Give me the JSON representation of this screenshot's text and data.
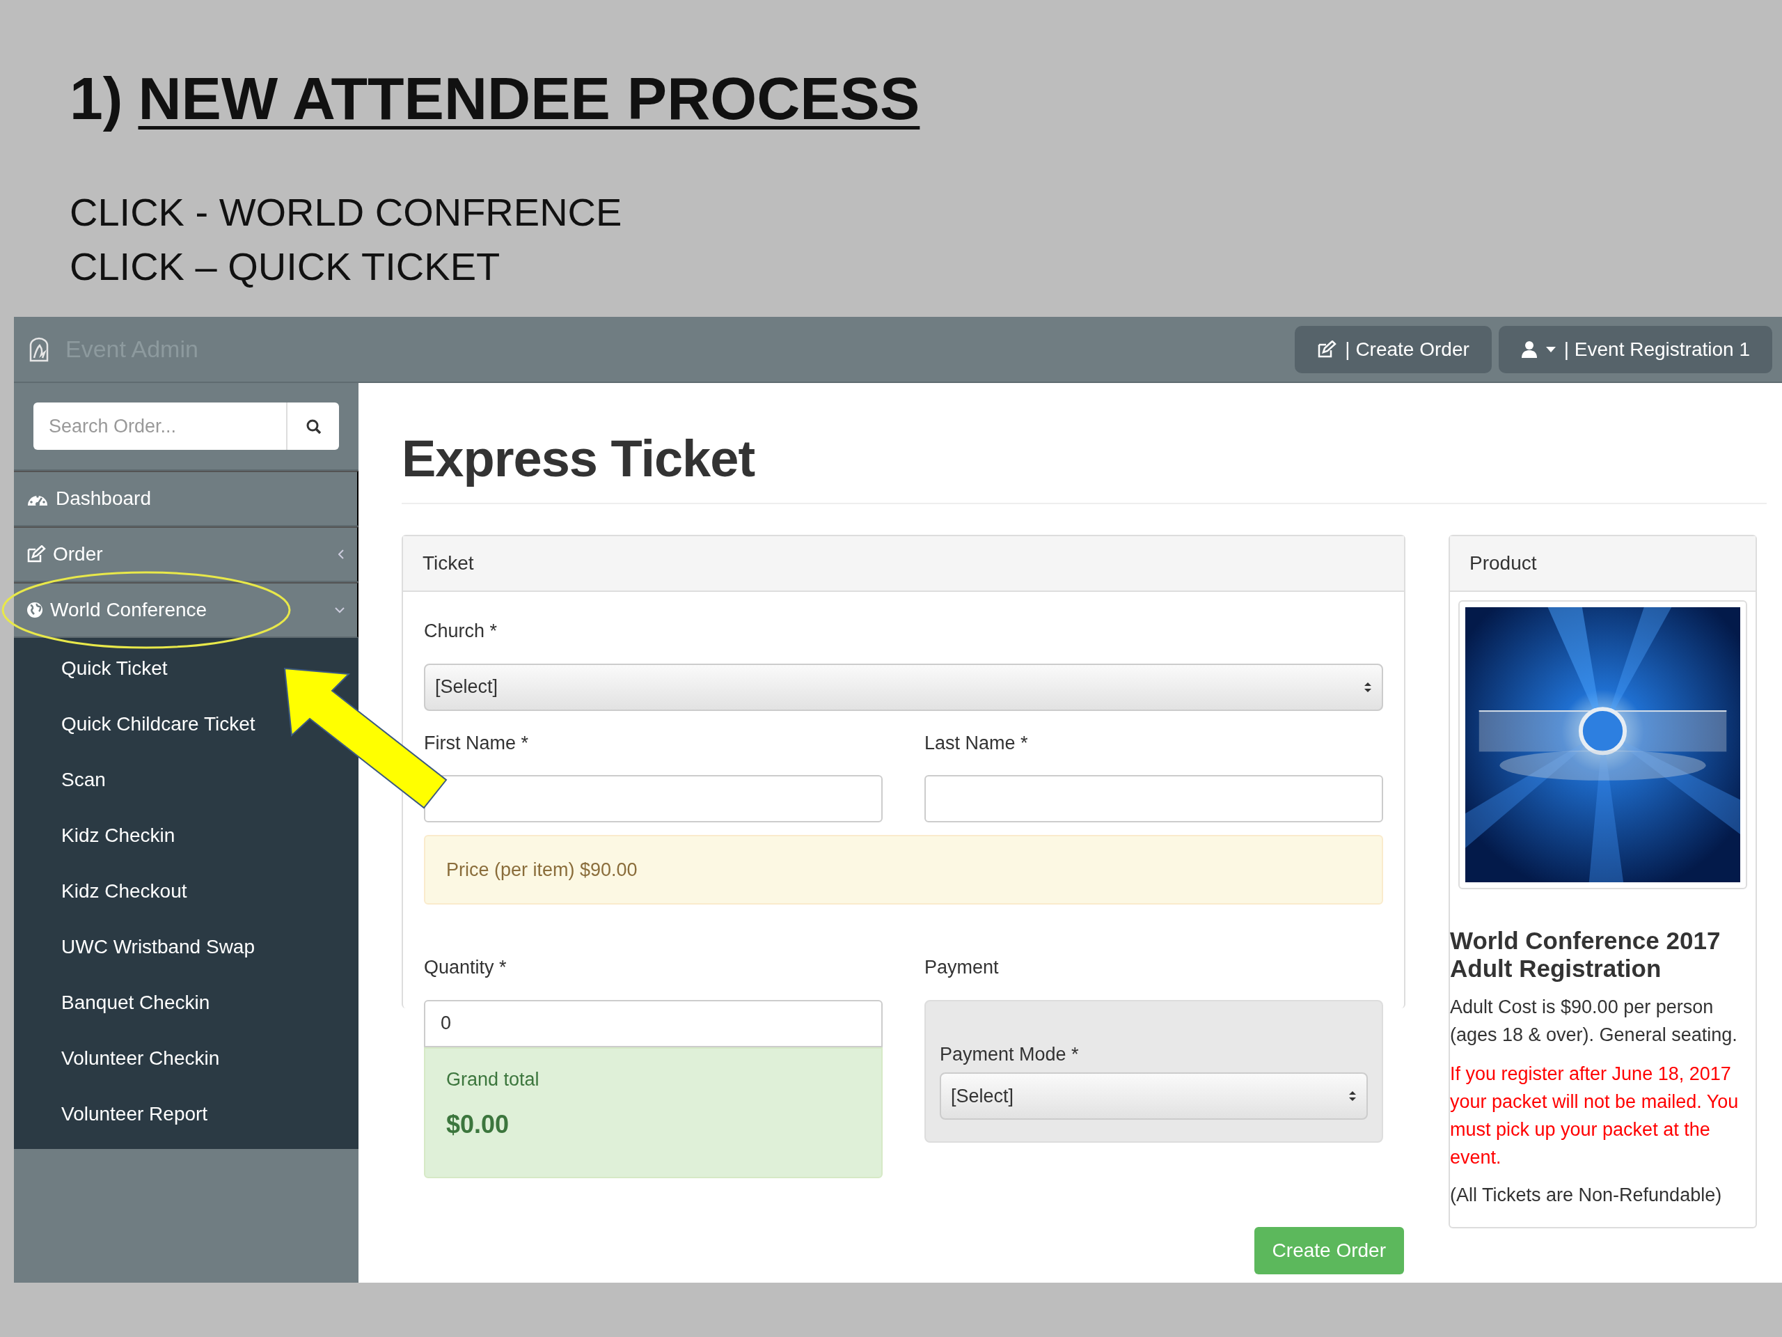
{
  "slide": {
    "heading_number": "1)",
    "heading": "NEW ATTENDEE PROCESS",
    "instructions": [
      "CLICK - WORLD CONFRENCE",
      "CLICK – QUICK TICKET"
    ]
  },
  "navbar": {
    "brand": "Event Admin",
    "buttons": [
      {
        "kind": "edit",
        "label": "| Create Order"
      },
      {
        "kind": "user",
        "label": "| Event Registration 1"
      }
    ]
  },
  "sidebar": {
    "search": {
      "placeholder": "Search Order..."
    },
    "items": [
      {
        "kind": "link",
        "label": "Dashboard",
        "annotated": false
      },
      {
        "kind": "menu",
        "label": "Order",
        "expanded": false,
        "annotated": false
      },
      {
        "kind": "menu",
        "label": "World Conference",
        "expanded": true,
        "annotated": true,
        "children": [
          {
            "label": "Quick Ticket",
            "annotated": true
          },
          {
            "label": "Quick Childcare Ticket",
            "annotated": false
          },
          {
            "label": "Scan",
            "annotated": false
          },
          {
            "label": "Kidz Checkin",
            "annotated": false
          },
          {
            "label": "Kidz Checkout",
            "annotated": false
          },
          {
            "label": "UWC Wristband Swap",
            "annotated": false
          },
          {
            "label": "Banquet Checkin",
            "annotated": false
          },
          {
            "label": "Volunteer Checkin",
            "annotated": false
          },
          {
            "label": "Volunteer Report",
            "annotated": false
          }
        ]
      }
    ]
  },
  "main": {
    "title": "Express Ticket",
    "ticket_panel": {
      "header": "Ticket",
      "church": {
        "label": "Church *",
        "value": "[Select]"
      },
      "first_name": {
        "label": "First Name *"
      },
      "last_name": {
        "label": "Last Name *"
      },
      "price_note": "Price (per item) $90.00",
      "quantity": {
        "label": "Quantity *",
        "value": "0"
      },
      "grand_total": {
        "label": "Grand total",
        "amount": "$0.00"
      },
      "payment": {
        "title": "Payment",
        "mode_label": "Payment Mode *",
        "value": "[Select]"
      },
      "submit": "Create Order"
    },
    "product_panel": {
      "header": "Product",
      "name": "World Conference 2017 Adult Registration",
      "description": "Adult Cost is $90.00 per person (ages 18 & over). General seating.",
      "warning": "If you register after June 18, 2017 your packet will not be mailed. You must pick up your packet at the event.",
      "note": "(All Tickets are Non-Refundable)"
    }
  }
}
